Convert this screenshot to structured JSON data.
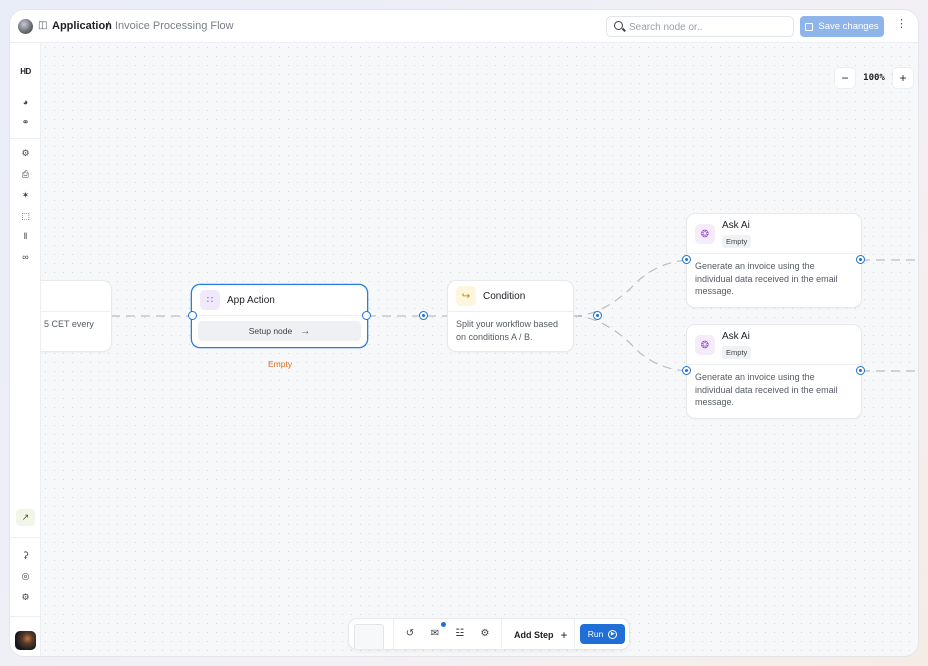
{
  "header": {
    "app_label": "Application",
    "separator": "/",
    "page_title": "Invoice Processing Flow",
    "search_placeholder": "Search node or..",
    "save_label": "Save changes"
  },
  "sidebar": {
    "brand": "HD",
    "items": [
      "gauge-icon",
      "link-icon",
      "robot-icon",
      "clipboard-icon",
      "puzzle-icon",
      "selection-icon",
      "library-icon",
      "chain-icon"
    ],
    "bottom_items": [
      "trend-icon",
      "bell-icon",
      "globe-icon",
      "gear-icon"
    ]
  },
  "zoom": {
    "minus": "−",
    "value": "100%",
    "plus": "+"
  },
  "nodes": {
    "trigger": {
      "body": "5 CET every"
    },
    "app_action": {
      "title": "App Action",
      "setup_label": "Setup node",
      "status": "Empty"
    },
    "condition": {
      "title": "Condition",
      "body": "Split your workflow based on conditions A / B."
    },
    "ask_ai_1": {
      "title": "Ask Ai",
      "badge": "Empty",
      "body": "Generate an invoice using the individual data received in the email message."
    },
    "ask_ai_2": {
      "title": "Ask Ai",
      "badge": "Empty",
      "body": "Generate an invoice using the individual data received in the email message."
    }
  },
  "toolbar": {
    "add_step": "Add Step",
    "add_icon": "+",
    "run_label": "Run"
  },
  "colors": {
    "accent": "#1f6fd6",
    "save_disabled": "#8fb4ea",
    "empty_status": "#e06a1b"
  }
}
